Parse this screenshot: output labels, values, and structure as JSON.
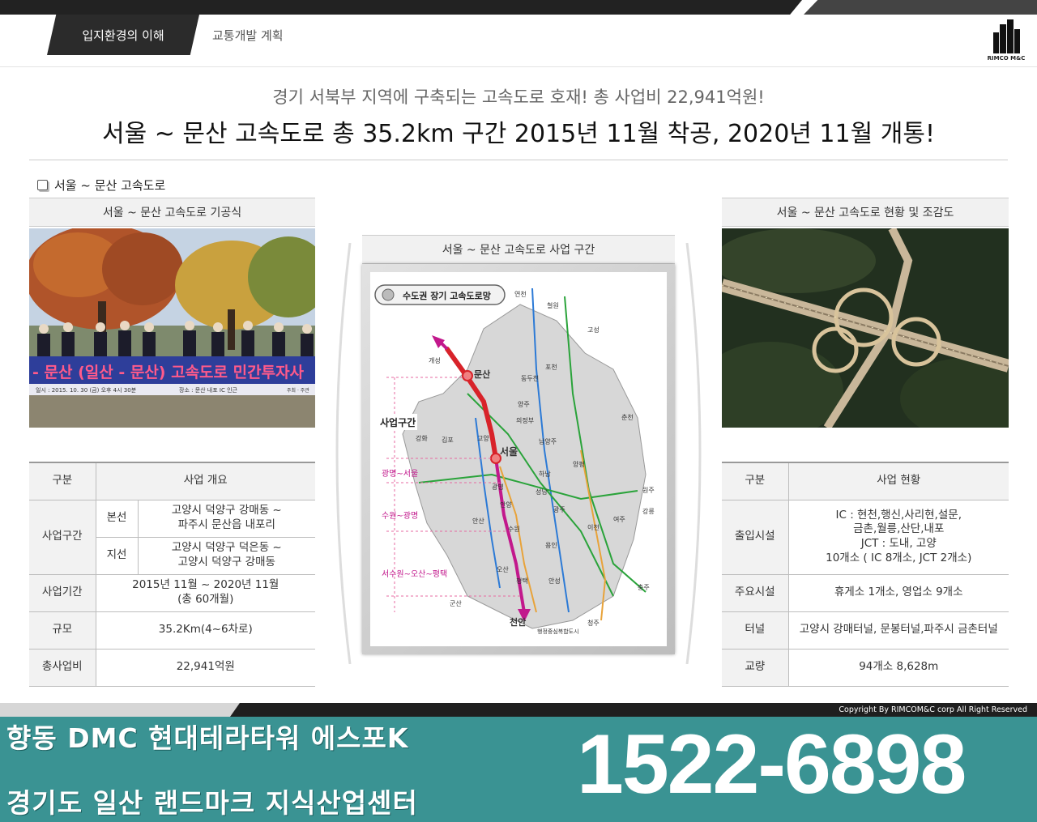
{
  "nav": {
    "active_tab": "입지환경의 이해",
    "tab_2": "교통개발 계획",
    "logo_text": "RIMCO M&C"
  },
  "headline": {
    "sub": "경기 서북부 지역에 구축되는 고속도로 호재! 총 사업비 22,941억원!",
    "main": "서울 ~ 문산 고속도로 총 35.2km 구간 2015년 11월 착공, 2020년 11월 개통!"
  },
  "section_title": "서울 ~ 문산 고속도로",
  "left_panel": {
    "caption": "서울 ~ 문산 고속도로 기공식",
    "banner_text": "- 문산 (일산 - 문산) 고속도로 민간투자사",
    "banner_sub": "일시 : 2015. 10. 30 (금) 오후 4시 30분",
    "banner_sub2": "장소 : 문산 내포 IC 인근",
    "banner_host": "주최 · 주관",
    "table": {
      "header": [
        "구분",
        "사업 개요"
      ],
      "rows": [
        {
          "label": "사업구간",
          "sub": "본선",
          "value_1": "고양시 덕양구 강매동 ~",
          "value_2": "파주시 문산읍 내포리"
        },
        {
          "sub": "지선",
          "value_1": "고양시 덕양구 덕은동 ~",
          "value_2": "고양시 덕양구 강매동"
        },
        {
          "label": "사업기간",
          "value_1": "2015년 11월 ~ 2020년 11월",
          "value_2": "(총 60개월)"
        },
        {
          "label": "규모",
          "value_1": "35.2Km(4~6차로)"
        },
        {
          "label": "총사업비",
          "value_1": "22,941억원"
        }
      ]
    }
  },
  "center_panel": {
    "caption": "서울 ~ 문산 고속도로 사업 구간",
    "map_title": "수도권 장기 고속도로망",
    "project_label": "사업구간",
    "segment_labels": [
      "광명~서울",
      "수원~광명",
      "서수원~오산~평택"
    ],
    "places": [
      "개성",
      "문산",
      "연천",
      "철원",
      "동두천",
      "포천",
      "양주",
      "의정부",
      "남양주",
      "고양",
      "김포",
      "강화",
      "서울",
      "광명",
      "하남",
      "성남",
      "광주",
      "양평",
      "안양",
      "안산",
      "수원",
      "용인",
      "이천",
      "여주",
      "원주",
      "강릉",
      "춘천",
      "고성",
      "평택",
      "오산",
      "안성",
      "천안",
      "청주",
      "충주",
      "군산",
      "행정중심복합도시"
    ]
  },
  "right_panel": {
    "caption": "서울 ~ 문산 고속도로 현황 및 조감도",
    "table": {
      "header": [
        "구분",
        "사업 현황"
      ],
      "rows": [
        {
          "label": "출입시설",
          "lines": [
            "IC : 현천,행신,사리현,설문,",
            "금촌,월릉,산단,내포",
            "JCT : 도내, 고양",
            "10개소 ( IC 8개소, JCT 2개소)"
          ]
        },
        {
          "label": "주요시설",
          "lines": [
            "휴게소 1개소, 영업소 9개소"
          ]
        },
        {
          "label": "터널",
          "lines": [
            "고양시 강매터널, 문봉터널,파주시 금촌터널"
          ]
        },
        {
          "label": "교량",
          "lines": [
            "94개소 8,628m"
          ]
        }
      ]
    }
  },
  "footer": {
    "copyright": "Copyright By RIMCOM&C corp All Right Reserved",
    "line_1": "향동 DMC 현대테라타워 에스포K",
    "line_2": "경기도 일산 랜드마크 지식산업센터",
    "phone": "1522-6898"
  }
}
